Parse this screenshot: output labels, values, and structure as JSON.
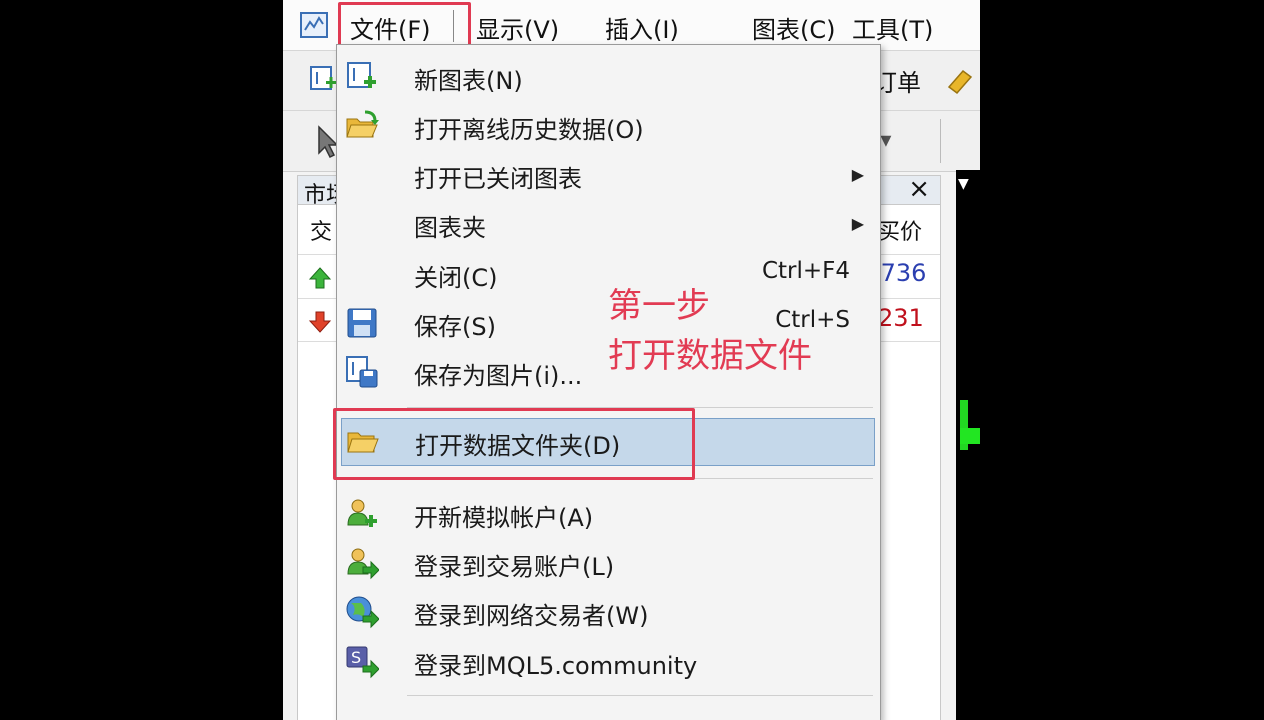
{
  "menubar": {
    "items": [
      "文件(F)",
      "显示(V)",
      "插入(I)",
      "图表(C)",
      "工具(T)"
    ]
  },
  "toolbar": {
    "order_label": "订单"
  },
  "market_panel": {
    "title": "市场",
    "col_symbol": "交",
    "col_ask": "买价",
    "rows": [
      {
        "direction": "up",
        "ask": ".736",
        "color": "#2b3fb0"
      },
      {
        "direction": "down",
        "ask": "231",
        "color": "#c0101c"
      }
    ]
  },
  "file_menu": {
    "items": [
      {
        "label": "新图表(N)",
        "icon": "new-chart-icon"
      },
      {
        "label": "打开离线历史数据(O)",
        "icon": "open-offline-icon"
      },
      {
        "label": "打开已关闭图表",
        "submenu": true
      },
      {
        "label": "图表夹",
        "submenu": true
      },
      {
        "label": "关闭(C)",
        "shortcut": "Ctrl+F4"
      },
      {
        "label": "保存(S)",
        "shortcut": "Ctrl+S",
        "icon": "save-icon"
      },
      {
        "label": "保存为图片(i)...",
        "icon": "save-picture-icon"
      },
      {
        "label": "打开数据文件夹(D)",
        "icon": "folder-icon",
        "selected": true
      },
      {
        "label": "开新模拟帐户(A)",
        "icon": "new-account-icon"
      },
      {
        "label": "登录到交易账户(L)",
        "icon": "login-account-icon"
      },
      {
        "label": "登录到网络交易者(W)",
        "icon": "web-trader-icon"
      },
      {
        "label": "登录到MQL5.community",
        "icon": "mql5-icon"
      }
    ]
  },
  "annotation": {
    "line1": "第一步",
    "line2": "打开数据文件"
  },
  "colors": {
    "highlight": "#e03a52",
    "selection": "#c5d8ea"
  }
}
